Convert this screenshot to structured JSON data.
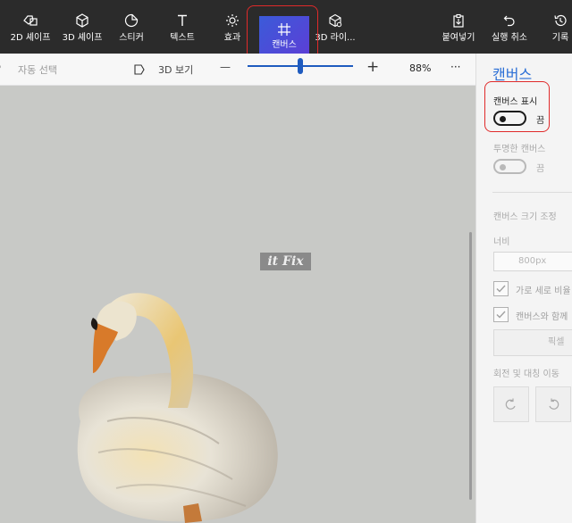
{
  "toolbar": {
    "tools": [
      {
        "label": "2D 셰이프",
        "icon": "2d-shapes-icon"
      },
      {
        "label": "3D 셰이프",
        "icon": "3d-shapes-icon"
      },
      {
        "label": "스티커",
        "icon": "sticker-icon"
      },
      {
        "label": "텍스트",
        "icon": "text-icon"
      },
      {
        "label": "효과",
        "icon": "effects-icon"
      },
      {
        "label": "캔버스",
        "icon": "canvas-icon",
        "active": true
      },
      {
        "label": "3D 라이...",
        "icon": "3d-library-icon"
      },
      {
        "label": "붙여넣기",
        "icon": "paste-icon"
      },
      {
        "label": "실행 취소",
        "icon": "undo-icon"
      },
      {
        "label": "기록",
        "icon": "history-icon"
      }
    ]
  },
  "subbar": {
    "auto_select": "자동 선택",
    "view_3d": "3D 보기",
    "zoom": "88%",
    "minus": "—",
    "plus": "+",
    "more": "···",
    "zoom_level": 0.5
  },
  "canvas": {
    "watermark": "it Fix"
  },
  "panel": {
    "title": "캔버스",
    "show_canvas_label": "캔버스 표시",
    "show_canvas_state": "끔",
    "transparent_label": "투명한 캔버스",
    "transparent_state": "끔",
    "resize_label": "캔버스 크기 조정",
    "width_label": "너비",
    "width_value": "800px",
    "lock_ratio_label": "가로 세로 비율",
    "resize_with_canvas_label": "캔버스와 함께",
    "pixel_button": "픽셀",
    "rotate_flip_label": "회전 및 대칭 이동"
  },
  "colors": {
    "toolbar_bg": "#2b2b2b",
    "accent": "#2b6fd6",
    "active_tool": "#4a4fd8",
    "highlight": "#e02a2a",
    "canvas_bg": "#c8c9c6"
  }
}
